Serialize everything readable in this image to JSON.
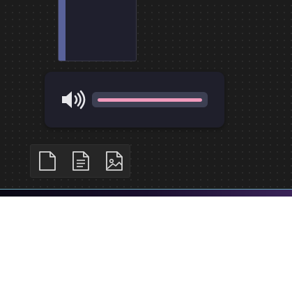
{
  "window_card": {
    "accent_color": "#59629a"
  },
  "volume": {
    "icon": "speaker-high-volume-icon",
    "level": 1.0,
    "fill_color": "#f19bbd",
    "track_color": "#3c3f52"
  },
  "doc_toolbar": {
    "buttons": [
      {
        "icon": "blank-document-icon"
      },
      {
        "icon": "text-document-icon"
      },
      {
        "icon": "image-document-icon"
      }
    ]
  },
  "bottom_bar": {
    "accent_color": "#6fb0c2"
  }
}
